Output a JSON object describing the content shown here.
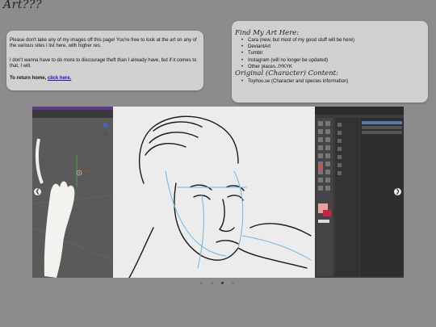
{
  "site": {
    "title": "Art???"
  },
  "notice": {
    "paragraph1": "Please don't take any of my images off this page! You're free to look at the art on any of the various sites I list here, with higher res.",
    "paragraph2": "I don't wanna have to do more to discourage theft than I already have, but if it comes to that, I will.",
    "return_text": "To return home, ",
    "return_link": "click here."
  },
  "links": {
    "find_heading": "Find My Art Here:",
    "find_items": [
      "Cara (new, but most of my good stuff will be here)",
      "DeviantArt",
      "Tumblr",
      "Instagram (will no longer be updated)",
      "Other places..IYKYK"
    ],
    "oc_heading": "Original (Character) Content:",
    "oc_items": [
      "Toyhou.se (Character and species information)"
    ]
  },
  "carousel": {
    "prev_icon": "chevron-left-icon",
    "next_icon": "chevron-right-icon",
    "slide_count": 4,
    "active_slide": 3
  },
  "colors": {
    "page_bg": "#8c8c8c",
    "card_bg": "#d0d0d0",
    "link": "#1a0dcc"
  }
}
